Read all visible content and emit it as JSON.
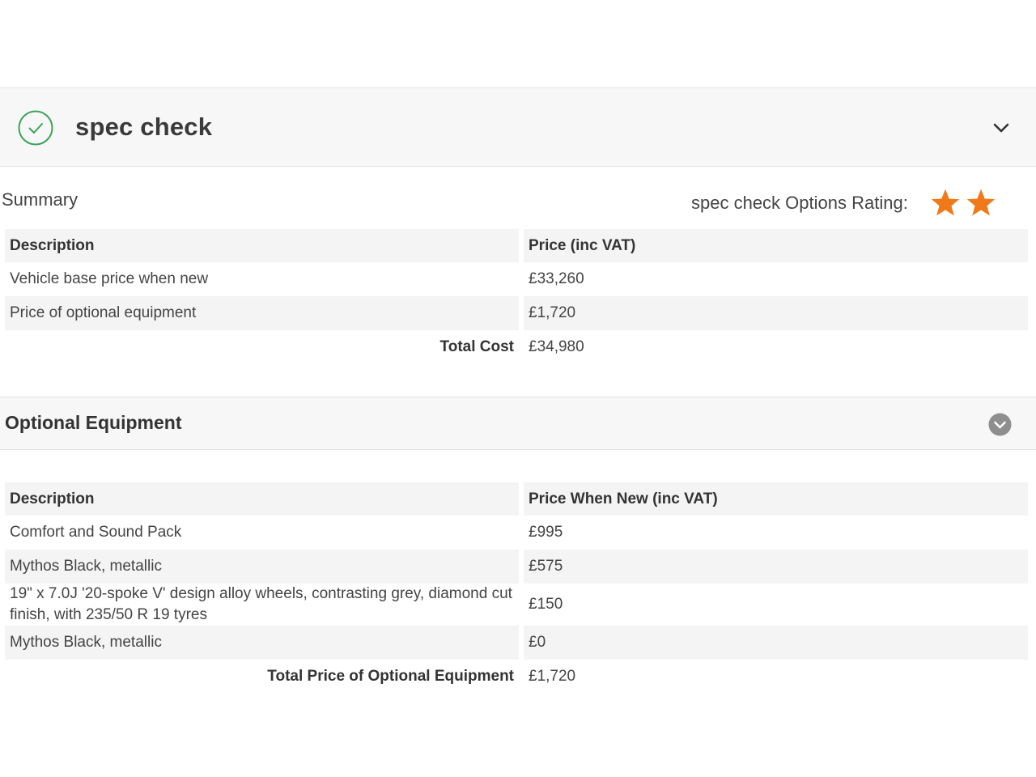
{
  "header": {
    "title": "spec check",
    "icons": {
      "check": "check-circle-icon",
      "toggle": "chevron-down-icon"
    },
    "accent_color": "#3aa35a"
  },
  "summary": {
    "label": "Summary",
    "rating_label": "spec check Options Rating:",
    "rating_stars": 2,
    "star_color": "#f07a1a",
    "columns": [
      "Description",
      "Price (inc VAT)"
    ],
    "rows": [
      {
        "description": "Vehicle base price when new",
        "price": "£33,260"
      },
      {
        "description": "Price of optional equipment",
        "price": "£1,720"
      }
    ],
    "total_label": "Total Cost",
    "total_value": "£34,980"
  },
  "optional_equipment": {
    "title": "Optional Equipment",
    "toggle_icon": "chevron-circle-down-icon",
    "columns": [
      "Description",
      "Price When New (inc VAT)"
    ],
    "rows": [
      {
        "description": "Comfort and Sound Pack",
        "price": "£995"
      },
      {
        "description": "Mythos Black, metallic",
        "price": "£575"
      },
      {
        "description": "19\" x 7.0J '20-spoke V' design alloy wheels, contrasting grey, diamond cut finish, with 235/50 R 19 tyres",
        "price": "£150"
      },
      {
        "description": "Mythos Black, metallic",
        "price": "£0"
      }
    ],
    "total_label": "Total Price of Optional Equipment",
    "total_value": "£1,720"
  }
}
